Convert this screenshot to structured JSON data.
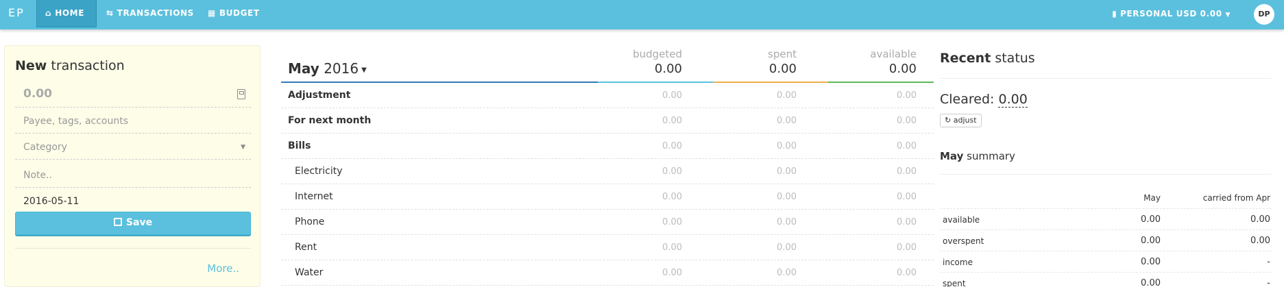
{
  "navbar": {
    "brand": "EP",
    "items": [
      {
        "label": "HOME",
        "active": true
      },
      {
        "label": "TRANSACTIONS",
        "active": false
      },
      {
        "label": "BUDGET",
        "active": false
      }
    ],
    "budget_selector": "PERSONAL USD 0.00",
    "avatar": "DP"
  },
  "new_transaction": {
    "title_bold": "New",
    "title_rest": " transaction",
    "amount_placeholder": "0.00",
    "payee_placeholder": "Payee, tags, accounts",
    "category_placeholder": "Category",
    "note_placeholder": "Note..",
    "date_value": "2016-05-11",
    "save_label": "Save",
    "more_label": "More.."
  },
  "budget_table": {
    "month_bold": "May",
    "year": "2016",
    "columns": [
      {
        "label": "budgeted",
        "total": "0.00",
        "color": "#5bc0de"
      },
      {
        "label": "spent",
        "total": "0.00",
        "color": "#f0ad4e"
      },
      {
        "label": "available",
        "total": "0.00",
        "color": "#5cb85c"
      }
    ],
    "header_line_color": "#337ab7",
    "rows": [
      {
        "name": "Adjustment",
        "group": true,
        "budgeted": "0.00",
        "spent": "0.00",
        "available": "0.00"
      },
      {
        "name": "For next month",
        "group": true,
        "budgeted": "0.00",
        "spent": "0.00",
        "available": "0.00"
      },
      {
        "name": "Bills",
        "group": true,
        "budgeted": "0.00",
        "spent": "0.00",
        "available": "0.00"
      },
      {
        "name": "Electricity",
        "group": false,
        "budgeted": "0.00",
        "spent": "0.00",
        "available": "0.00"
      },
      {
        "name": "Internet",
        "group": false,
        "budgeted": "0.00",
        "spent": "0.00",
        "available": "0.00"
      },
      {
        "name": "Phone",
        "group": false,
        "budgeted": "0.00",
        "spent": "0.00",
        "available": "0.00"
      },
      {
        "name": "Rent",
        "group": false,
        "budgeted": "0.00",
        "spent": "0.00",
        "available": "0.00"
      },
      {
        "name": "Water",
        "group": false,
        "budgeted": "0.00",
        "spent": "0.00",
        "available": "0.00"
      }
    ]
  },
  "recent_status": {
    "title_bold": "Recent",
    "title_rest": " status",
    "cleared_label": "Cleared:",
    "cleared_value": "0.00",
    "adjust_label": "adjust"
  },
  "summary": {
    "title_bold": "May",
    "title_rest": " summary",
    "col_may": "May",
    "col_carry": "carried from Apr",
    "rows": [
      {
        "key": "available",
        "may": "0.00",
        "carry": "0.00"
      },
      {
        "key": "overspent",
        "may": "0.00",
        "carry": "0.00"
      },
      {
        "key": "income",
        "may": "0.00",
        "carry": "-"
      },
      {
        "key": "spent",
        "may": "0.00",
        "carry": "-"
      }
    ]
  }
}
